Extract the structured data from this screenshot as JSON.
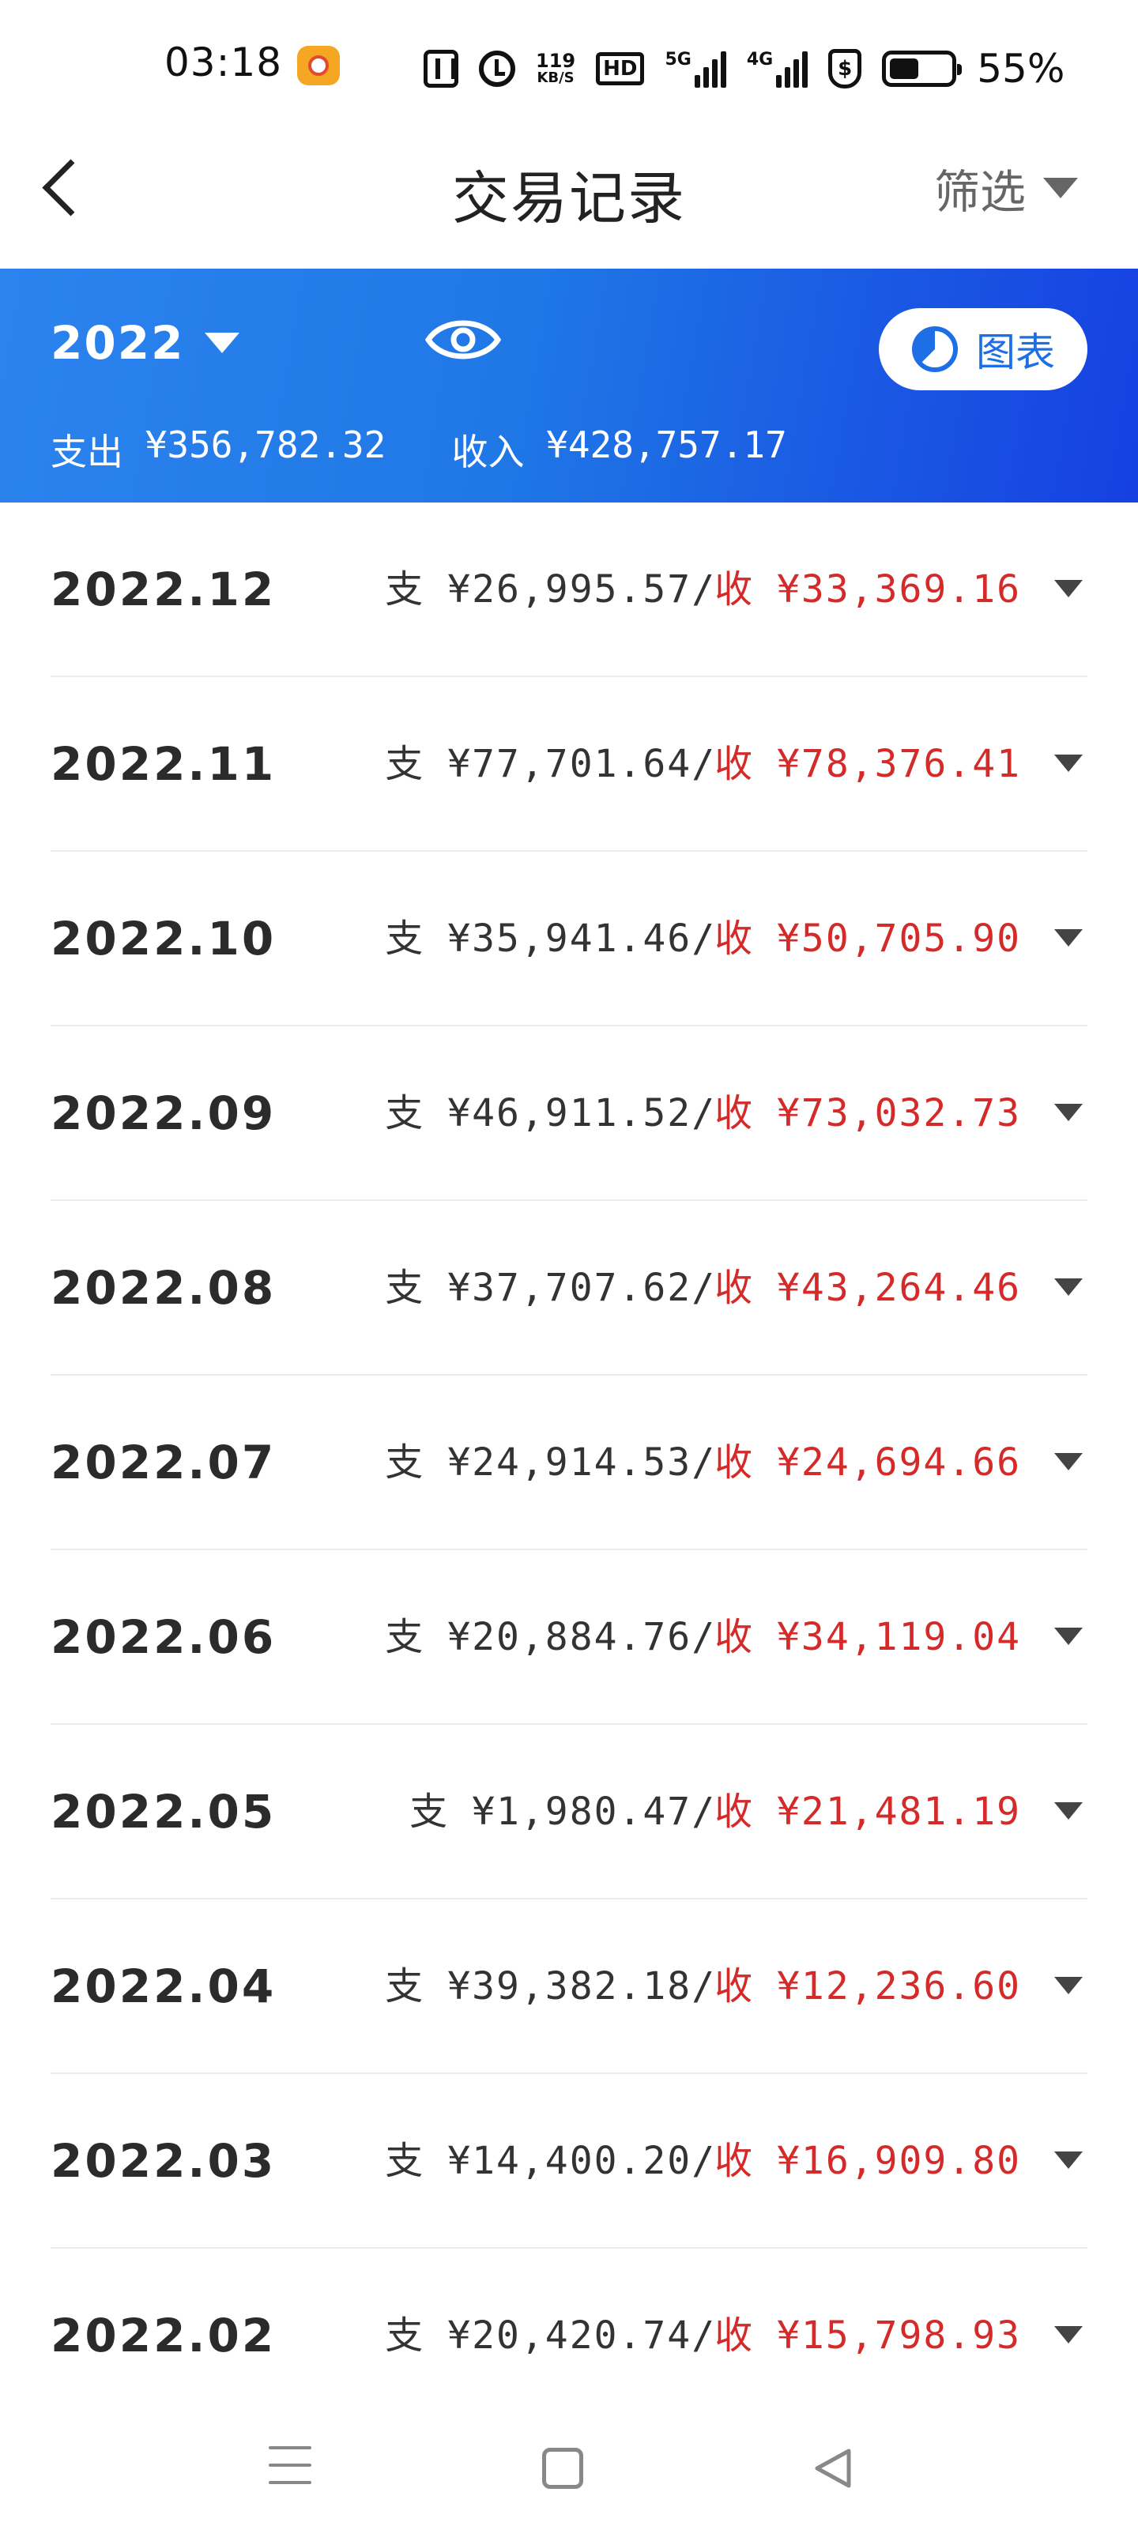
{
  "status_bar": {
    "time": "03:18",
    "speed_value": "119",
    "speed_unit": "KB/S",
    "hd_label": "HD",
    "net_5g": "5G",
    "net_4g": "4G",
    "battery_pct": "55%",
    "battery_level": 0.55
  },
  "header": {
    "title": "交易记录",
    "filter_label": "筛选"
  },
  "summary": {
    "year": "2022",
    "chart_button_label": "图表",
    "expense_label": "支出",
    "expense_value": "¥356,782.32",
    "income_label": "收入",
    "income_value": "¥428,757.17"
  },
  "labels": {
    "expense_short": "支",
    "income_short": "收"
  },
  "colors": {
    "banner_start": "#2c83ee",
    "banner_end": "#1640e1",
    "income_red": "#d42a2a",
    "accent_blue": "#1e6fe6"
  },
  "months": [
    {
      "month": "2022.12",
      "expense": "¥26,995.57",
      "income": "¥33,369.16"
    },
    {
      "month": "2022.11",
      "expense": "¥77,701.64",
      "income": "¥78,376.41"
    },
    {
      "month": "2022.10",
      "expense": "¥35,941.46",
      "income": "¥50,705.90"
    },
    {
      "month": "2022.09",
      "expense": "¥46,911.52",
      "income": "¥73,032.73"
    },
    {
      "month": "2022.08",
      "expense": "¥37,707.62",
      "income": "¥43,264.46"
    },
    {
      "month": "2022.07",
      "expense": "¥24,914.53",
      "income": "¥24,694.66"
    },
    {
      "month": "2022.06",
      "expense": "¥20,884.76",
      "income": "¥34,119.04"
    },
    {
      "month": "2022.05",
      "expense": "¥1,980.47",
      "income": "¥21,481.19"
    },
    {
      "month": "2022.04",
      "expense": "¥39,382.18",
      "income": "¥12,236.60"
    },
    {
      "month": "2022.03",
      "expense": "¥14,400.20",
      "income": "¥16,909.80"
    },
    {
      "month": "2022.02",
      "expense": "¥20,420.74",
      "income": "¥15,798.93"
    }
  ],
  "icons": {
    "back": "chevron-left-icon",
    "filter_caret": "caret-down-icon",
    "eye": "eye-icon",
    "chart": "pie-chart-icon",
    "row_caret": "caret-down-icon",
    "nav_menu": "menu-icon",
    "nav_home": "home-square-icon",
    "nav_back": "back-triangle-icon"
  }
}
